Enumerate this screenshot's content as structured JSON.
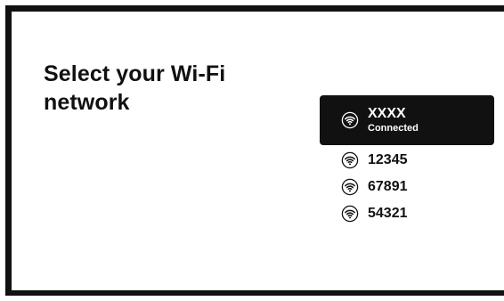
{
  "title": "Select your Wi-Fi network",
  "networks": [
    {
      "name": "XXXX",
      "status": "Connected",
      "icon": "wifi-icon"
    },
    {
      "name": "12345",
      "icon": "wifi-icon"
    },
    {
      "name": "67891",
      "icon": "wifi-icon"
    },
    {
      "name": "54321",
      "icon": "wifi-icon"
    }
  ],
  "colors": {
    "frame": "#111111",
    "background": "#ffffff",
    "selected_bg": "#111111",
    "selected_text": "#ffffff",
    "text": "#111111"
  }
}
